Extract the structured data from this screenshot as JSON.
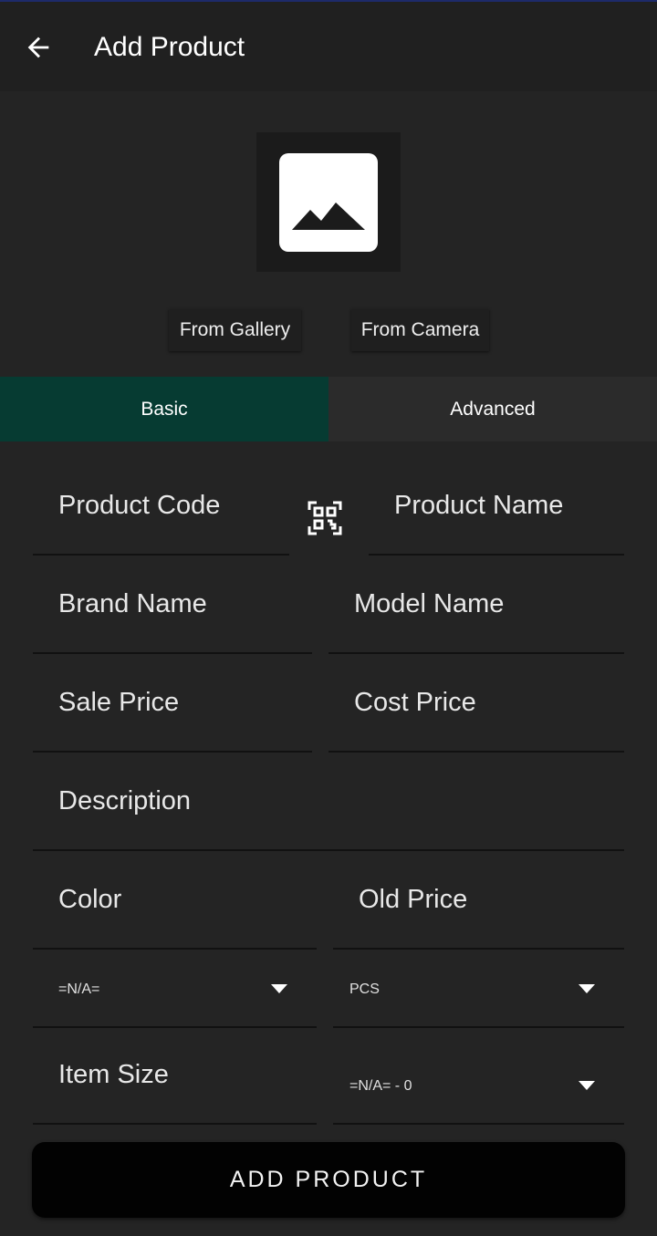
{
  "header": {
    "back_icon": "arrow-left-icon",
    "title": "Add Product"
  },
  "image_picker": {
    "placeholder_icon": "image-icon",
    "gallery_label": "From Gallery",
    "camera_label": "From Camera"
  },
  "tabs": [
    {
      "label": "Basic",
      "active": true
    },
    {
      "label": "Advanced",
      "active": false
    }
  ],
  "colors": {
    "active_tab": "#063b32",
    "background": "#242424",
    "button": "#020202"
  },
  "form": {
    "product_code": "Product Code",
    "scan_icon": "qr-code-scan-icon",
    "product_name": "Product Name",
    "brand_name": "Brand Name",
    "model_name": "Model Name",
    "sale_price": "Sale Price",
    "cost_price": "Cost Price",
    "description": "Description",
    "color": "Color",
    "old_price": "Old Price",
    "category_select": "=N/A=",
    "unit_select": "PCS",
    "item_size": "Item Size",
    "size_select": "=N/A= - 0"
  },
  "submit_label": "ADD PRODUCT"
}
